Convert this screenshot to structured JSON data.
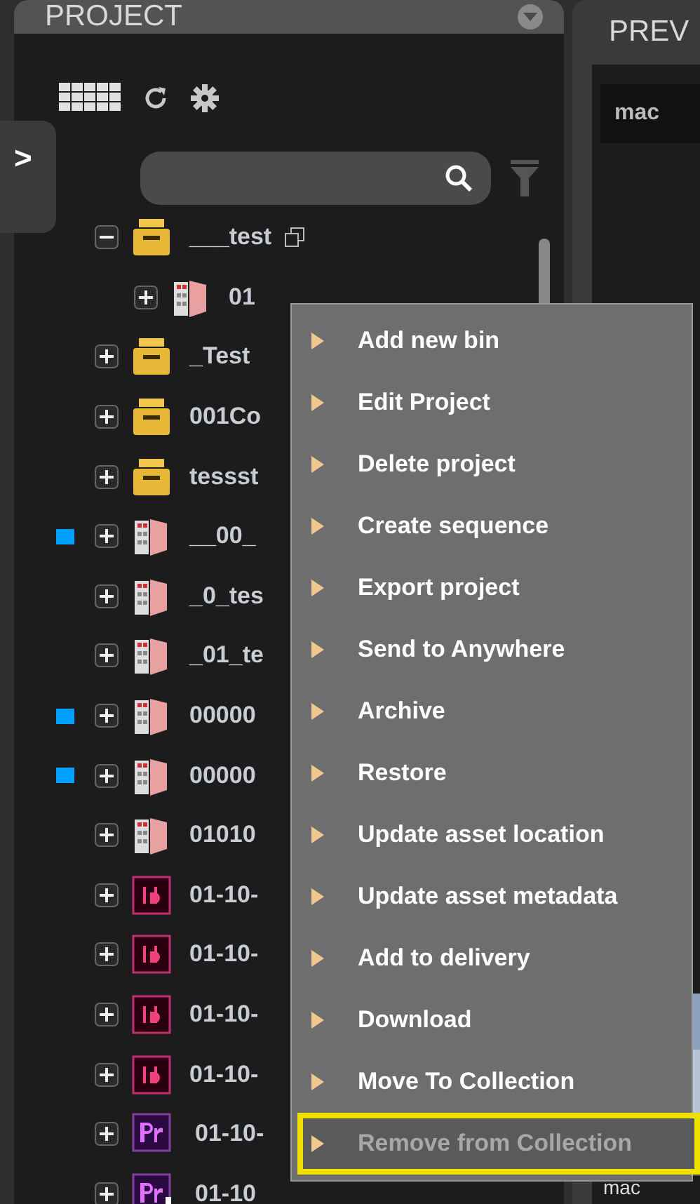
{
  "project_panel": {
    "title": "PROJECT",
    "side_tab": ">",
    "tree": [
      {
        "label": "___test",
        "kind": "project",
        "expanded": true,
        "selected": true,
        "flagged": false,
        "children": [
          {
            "label": "01",
            "kind": "sequence",
            "expanded": false,
            "selected": false,
            "flagged": false
          }
        ]
      },
      {
        "label": "_Test",
        "kind": "project",
        "expanded": false,
        "selected": false,
        "flagged": false
      },
      {
        "label": "001Co",
        "kind": "project",
        "expanded": false,
        "selected": false,
        "flagged": false
      },
      {
        "label": "tessst",
        "kind": "project",
        "expanded": false,
        "selected": false,
        "flagged": false
      },
      {
        "label": "__00_",
        "kind": "sequence",
        "expanded": false,
        "selected": false,
        "flagged": true
      },
      {
        "label": "_0_tes",
        "kind": "sequence",
        "expanded": false,
        "selected": false,
        "flagged": false
      },
      {
        "label": "_01_te",
        "kind": "sequence",
        "expanded": false,
        "selected": false,
        "flagged": false
      },
      {
        "label": "00000",
        "kind": "sequence",
        "expanded": false,
        "selected": false,
        "flagged": true
      },
      {
        "label": "00000",
        "kind": "sequence",
        "expanded": false,
        "selected": false,
        "flagged": true
      },
      {
        "label": "01010",
        "kind": "sequence",
        "expanded": false,
        "selected": false,
        "flagged": false
      },
      {
        "label": "01-10-",
        "kind": "indesign",
        "expanded": false,
        "selected": false,
        "flagged": false
      },
      {
        "label": "01-10-",
        "kind": "indesign",
        "expanded": false,
        "selected": false,
        "flagged": false
      },
      {
        "label": "01-10-",
        "kind": "indesign",
        "expanded": false,
        "selected": false,
        "flagged": false
      },
      {
        "label": "01-10-",
        "kind": "indesign",
        "expanded": false,
        "selected": false,
        "flagged": false
      },
      {
        "label": "01-10-",
        "kind": "premiere",
        "expanded": false,
        "selected": false,
        "flagged": false
      },
      {
        "label": "01-10",
        "kind": "premiere_download",
        "expanded": false,
        "selected": false,
        "flagged": false
      }
    ]
  },
  "preview_panel": {
    "title": "PREV",
    "clip_label": "mac",
    "footer_label": "mac"
  },
  "context_menu": [
    {
      "label": "Add new bin",
      "disabled": false,
      "selected": false
    },
    {
      "label": "Edit Project",
      "disabled": false,
      "selected": false
    },
    {
      "label": "Delete project",
      "disabled": false,
      "selected": false
    },
    {
      "label": "Create sequence",
      "disabled": false,
      "selected": false
    },
    {
      "label": "Export project",
      "disabled": false,
      "selected": false
    },
    {
      "label": "Send to Anywhere",
      "disabled": false,
      "selected": false
    },
    {
      "label": "Archive",
      "disabled": false,
      "selected": false
    },
    {
      "label": "Restore",
      "disabled": false,
      "selected": false
    },
    {
      "label": "Update asset location",
      "disabled": false,
      "selected": false
    },
    {
      "label": "Update asset metadata",
      "disabled": false,
      "selected": false
    },
    {
      "label": "Add to delivery",
      "disabled": false,
      "selected": false
    },
    {
      "label": "Download",
      "disabled": false,
      "selected": false
    },
    {
      "label": "Move To Collection",
      "disabled": false,
      "selected": false
    },
    {
      "label": "Remove from Collection",
      "disabled": true,
      "selected": true
    }
  ]
}
